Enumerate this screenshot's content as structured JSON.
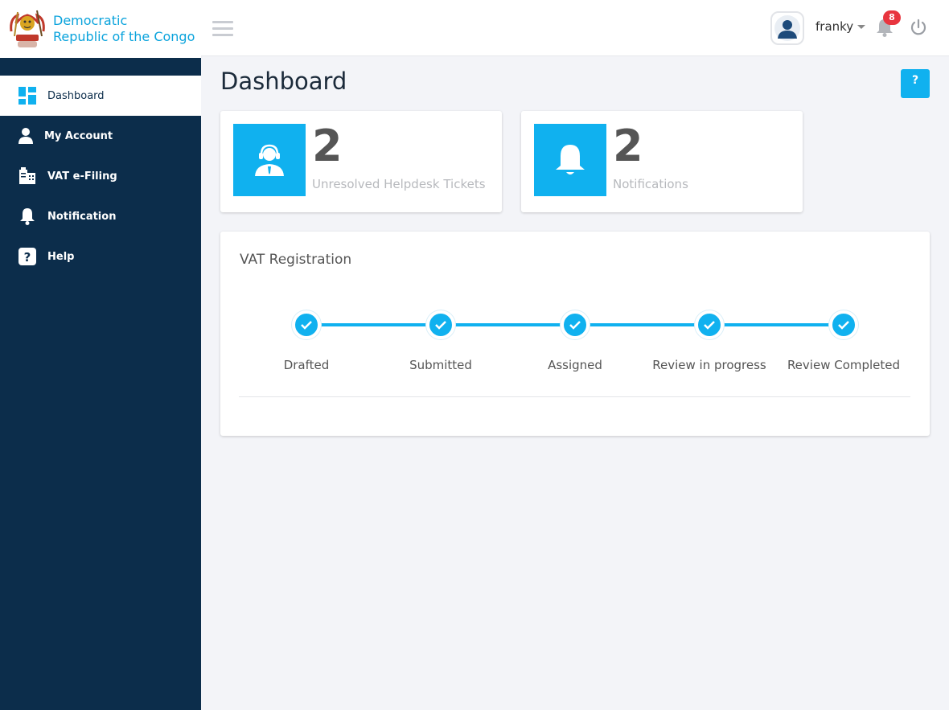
{
  "brand": {
    "title_line1": "Democratic",
    "title_line2": "Republic of the Congo"
  },
  "sidebar": {
    "items": [
      {
        "label": "Dashboard",
        "icon": "dashboard-grid-icon",
        "active": true
      },
      {
        "label": "My Account",
        "icon": "user-icon"
      },
      {
        "label": "VAT e-Filing",
        "icon": "filing-icon"
      },
      {
        "label": "Notification",
        "icon": "bell-icon"
      },
      {
        "label": "Help",
        "icon": "question-icon"
      }
    ]
  },
  "header": {
    "user_name": "franky",
    "notification_count": "8"
  },
  "main": {
    "page_title": "Dashboard",
    "help_button": "?",
    "stats": [
      {
        "value": "2",
        "label": "Unresolved Helpdesk Tickets",
        "icon": "helpdesk-agent-icon"
      },
      {
        "value": "2",
        "label": "Notifications",
        "icon": "bell-icon"
      }
    ],
    "registration": {
      "title": "VAT Registration",
      "steps": [
        {
          "label": "Drafted",
          "done": true
        },
        {
          "label": "Submitted",
          "done": true
        },
        {
          "label": "Assigned",
          "done": true
        },
        {
          "label": "Review in progress",
          "done": true
        },
        {
          "label": "Review Completed",
          "done": true
        }
      ]
    }
  },
  "colors": {
    "accent": "#10b1ef",
    "sidebar": "#0c2d4b",
    "badge": "#e8353f"
  }
}
